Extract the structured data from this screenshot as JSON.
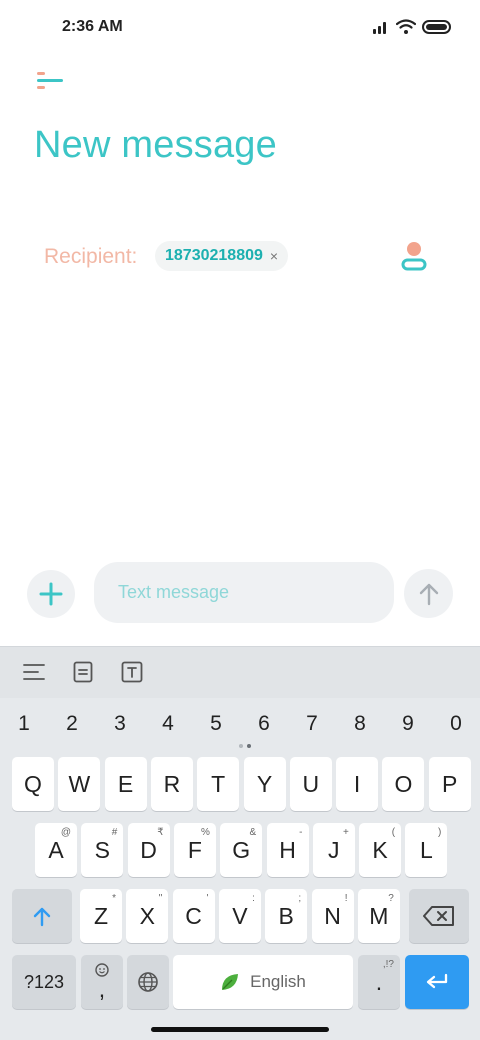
{
  "status_bar": {
    "time": "2:36 AM",
    "icons": [
      "signal-icon",
      "wifi-icon",
      "battery-icon"
    ]
  },
  "header": {
    "title": "New message",
    "menu_icon": "menu-icon"
  },
  "recipient": {
    "label": "Recipient:",
    "chips": [
      {
        "value": "18730218809",
        "remove_symbol": "×"
      }
    ],
    "contact_icon": "contact-picker-icon"
  },
  "composer": {
    "placeholder": "Text message",
    "value": "",
    "attach_icon": "plus-icon",
    "send_icon": "send-arrow-icon"
  },
  "keyboard": {
    "toolbar": [
      "menu-lines-icon",
      "clipboard-icon",
      "text-format-icon"
    ],
    "numbers": [
      "1",
      "2",
      "3",
      "4",
      "5",
      "6",
      "7",
      "8",
      "9",
      "0"
    ],
    "row1": [
      {
        "k": "Q"
      },
      {
        "k": "W"
      },
      {
        "k": "E"
      },
      {
        "k": "R"
      },
      {
        "k": "T"
      },
      {
        "k": "Y"
      },
      {
        "k": "U"
      },
      {
        "k": "I"
      },
      {
        "k": "O"
      },
      {
        "k": "P"
      }
    ],
    "row2": [
      {
        "k": "A",
        "h": "@"
      },
      {
        "k": "S",
        "h": "#"
      },
      {
        "k": "D",
        "h": "₹"
      },
      {
        "k": "F",
        "h": "%"
      },
      {
        "k": "G",
        "h": "&"
      },
      {
        "k": "H",
        "h": "-"
      },
      {
        "k": "J",
        "h": "+"
      },
      {
        "k": "K",
        "h": "("
      },
      {
        "k": "L",
        "h": ")"
      }
    ],
    "row3": [
      {
        "k": "Z",
        "h": "*"
      },
      {
        "k": "X",
        "h": "\""
      },
      {
        "k": "C",
        "h": "'"
      },
      {
        "k": "V",
        "h": ":"
      },
      {
        "k": "B",
        "h": ";"
      },
      {
        "k": "N",
        "h": "!"
      },
      {
        "k": "M",
        "h": "?"
      }
    ],
    "symbols_label": "?123",
    "comma": ",",
    "space_label": "English",
    "period": ".",
    "period_hint": ",!?",
    "colors": {
      "enter": "#2f9bf2",
      "accent": "#3cc5c6"
    }
  }
}
